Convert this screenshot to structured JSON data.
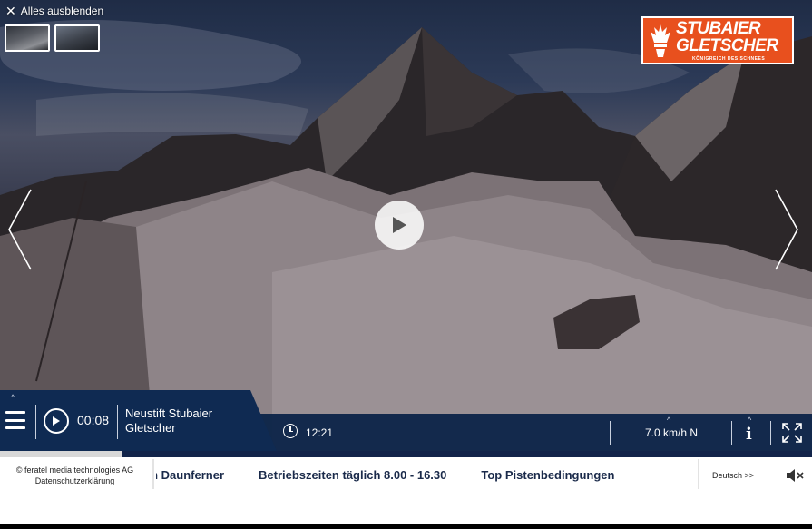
{
  "overlay": {
    "hide_all_label": "Alles ausblenden",
    "thumbnails": [
      "thumb-1",
      "thumb-2"
    ]
  },
  "logo": {
    "line1": "STUBAIER",
    "line2": "GLETSCHER",
    "tagline": "KÖNIGREICH DES SCHNEES",
    "color": "#e8501e"
  },
  "controls": {
    "elapsed": "00:08",
    "location": "Neustift Stubaier Gletscher",
    "clock_time": "12:21",
    "wind": "7.0 km/h N",
    "info_label": "i",
    "progress_percent": 15
  },
  "footer": {
    "copyright": "© feratel media technologies AG",
    "privacy": "Datenschutzerklärung",
    "ticker": [
      "Windach Daunferner",
      "Betriebszeiten täglich 8.00 - 16.30",
      "Top Pistenbedingungen"
    ],
    "language": "Deutsch >>"
  },
  "colors": {
    "bar": "#0f2a52",
    "accent": "#e8501e"
  },
  "icons": [
    "close-icon",
    "menu-icon",
    "play-icon",
    "clock-icon",
    "info-icon",
    "fullscreen-icon",
    "mute-icon",
    "chevron-left-icon",
    "chevron-right-icon",
    "caret-up-icon"
  ]
}
